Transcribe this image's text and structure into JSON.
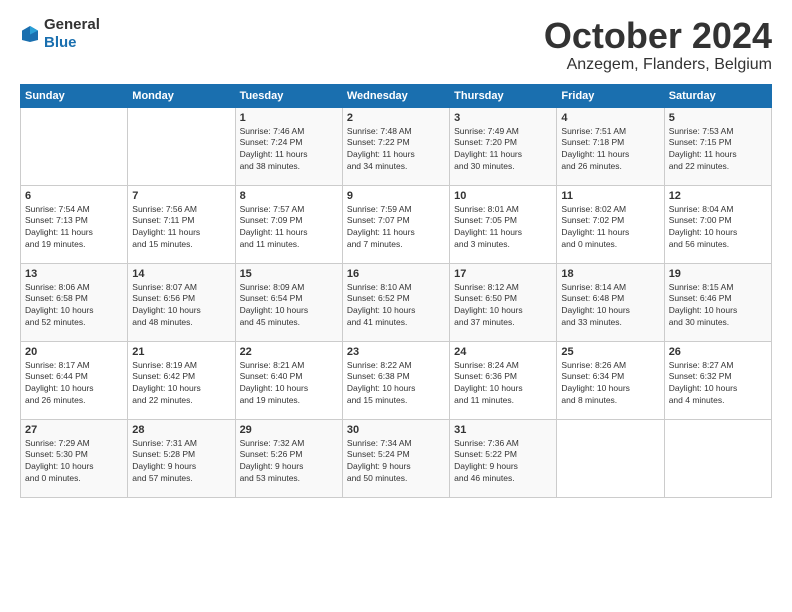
{
  "logo": {
    "general": "General",
    "blue": "Blue"
  },
  "header": {
    "month": "October 2024",
    "location": "Anzegem, Flanders, Belgium"
  },
  "weekdays": [
    "Sunday",
    "Monday",
    "Tuesday",
    "Wednesday",
    "Thursday",
    "Friday",
    "Saturday"
  ],
  "weeks": [
    [
      {
        "num": "",
        "info": ""
      },
      {
        "num": "",
        "info": ""
      },
      {
        "num": "1",
        "info": "Sunrise: 7:46 AM\nSunset: 7:24 PM\nDaylight: 11 hours\nand 38 minutes."
      },
      {
        "num": "2",
        "info": "Sunrise: 7:48 AM\nSunset: 7:22 PM\nDaylight: 11 hours\nand 34 minutes."
      },
      {
        "num": "3",
        "info": "Sunrise: 7:49 AM\nSunset: 7:20 PM\nDaylight: 11 hours\nand 30 minutes."
      },
      {
        "num": "4",
        "info": "Sunrise: 7:51 AM\nSunset: 7:18 PM\nDaylight: 11 hours\nand 26 minutes."
      },
      {
        "num": "5",
        "info": "Sunrise: 7:53 AM\nSunset: 7:15 PM\nDaylight: 11 hours\nand 22 minutes."
      }
    ],
    [
      {
        "num": "6",
        "info": "Sunrise: 7:54 AM\nSunset: 7:13 PM\nDaylight: 11 hours\nand 19 minutes."
      },
      {
        "num": "7",
        "info": "Sunrise: 7:56 AM\nSunset: 7:11 PM\nDaylight: 11 hours\nand 15 minutes."
      },
      {
        "num": "8",
        "info": "Sunrise: 7:57 AM\nSunset: 7:09 PM\nDaylight: 11 hours\nand 11 minutes."
      },
      {
        "num": "9",
        "info": "Sunrise: 7:59 AM\nSunset: 7:07 PM\nDaylight: 11 hours\nand 7 minutes."
      },
      {
        "num": "10",
        "info": "Sunrise: 8:01 AM\nSunset: 7:05 PM\nDaylight: 11 hours\nand 3 minutes."
      },
      {
        "num": "11",
        "info": "Sunrise: 8:02 AM\nSunset: 7:02 PM\nDaylight: 11 hours\nand 0 minutes."
      },
      {
        "num": "12",
        "info": "Sunrise: 8:04 AM\nSunset: 7:00 PM\nDaylight: 10 hours\nand 56 minutes."
      }
    ],
    [
      {
        "num": "13",
        "info": "Sunrise: 8:06 AM\nSunset: 6:58 PM\nDaylight: 10 hours\nand 52 minutes."
      },
      {
        "num": "14",
        "info": "Sunrise: 8:07 AM\nSunset: 6:56 PM\nDaylight: 10 hours\nand 48 minutes."
      },
      {
        "num": "15",
        "info": "Sunrise: 8:09 AM\nSunset: 6:54 PM\nDaylight: 10 hours\nand 45 minutes."
      },
      {
        "num": "16",
        "info": "Sunrise: 8:10 AM\nSunset: 6:52 PM\nDaylight: 10 hours\nand 41 minutes."
      },
      {
        "num": "17",
        "info": "Sunrise: 8:12 AM\nSunset: 6:50 PM\nDaylight: 10 hours\nand 37 minutes."
      },
      {
        "num": "18",
        "info": "Sunrise: 8:14 AM\nSunset: 6:48 PM\nDaylight: 10 hours\nand 33 minutes."
      },
      {
        "num": "19",
        "info": "Sunrise: 8:15 AM\nSunset: 6:46 PM\nDaylight: 10 hours\nand 30 minutes."
      }
    ],
    [
      {
        "num": "20",
        "info": "Sunrise: 8:17 AM\nSunset: 6:44 PM\nDaylight: 10 hours\nand 26 minutes."
      },
      {
        "num": "21",
        "info": "Sunrise: 8:19 AM\nSunset: 6:42 PM\nDaylight: 10 hours\nand 22 minutes."
      },
      {
        "num": "22",
        "info": "Sunrise: 8:21 AM\nSunset: 6:40 PM\nDaylight: 10 hours\nand 19 minutes."
      },
      {
        "num": "23",
        "info": "Sunrise: 8:22 AM\nSunset: 6:38 PM\nDaylight: 10 hours\nand 15 minutes."
      },
      {
        "num": "24",
        "info": "Sunrise: 8:24 AM\nSunset: 6:36 PM\nDaylight: 10 hours\nand 11 minutes."
      },
      {
        "num": "25",
        "info": "Sunrise: 8:26 AM\nSunset: 6:34 PM\nDaylight: 10 hours\nand 8 minutes."
      },
      {
        "num": "26",
        "info": "Sunrise: 8:27 AM\nSunset: 6:32 PM\nDaylight: 10 hours\nand 4 minutes."
      }
    ],
    [
      {
        "num": "27",
        "info": "Sunrise: 7:29 AM\nSunset: 5:30 PM\nDaylight: 10 hours\nand 0 minutes."
      },
      {
        "num": "28",
        "info": "Sunrise: 7:31 AM\nSunset: 5:28 PM\nDaylight: 9 hours\nand 57 minutes."
      },
      {
        "num": "29",
        "info": "Sunrise: 7:32 AM\nSunset: 5:26 PM\nDaylight: 9 hours\nand 53 minutes."
      },
      {
        "num": "30",
        "info": "Sunrise: 7:34 AM\nSunset: 5:24 PM\nDaylight: 9 hours\nand 50 minutes."
      },
      {
        "num": "31",
        "info": "Sunrise: 7:36 AM\nSunset: 5:22 PM\nDaylight: 9 hours\nand 46 minutes."
      },
      {
        "num": "",
        "info": ""
      },
      {
        "num": "",
        "info": ""
      }
    ]
  ]
}
